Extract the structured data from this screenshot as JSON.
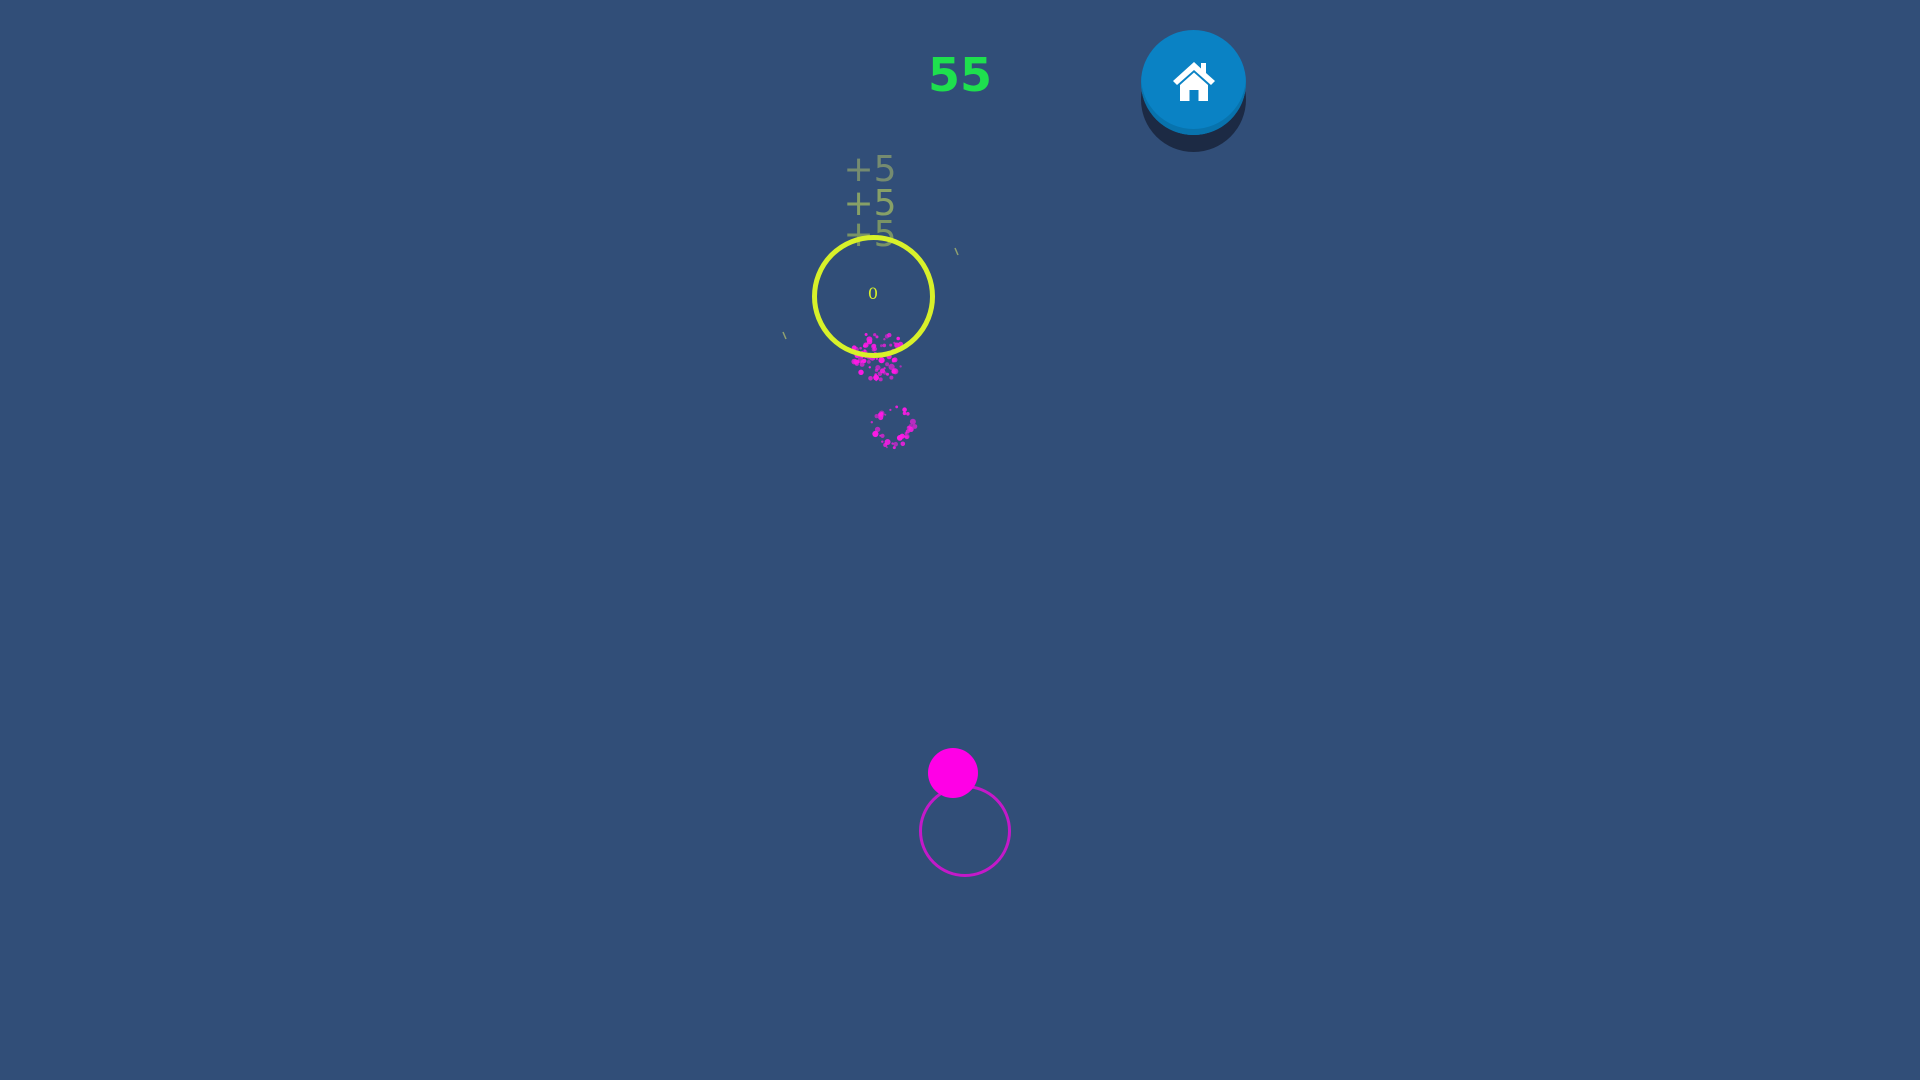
{
  "hud": {
    "score": "55",
    "home_button_icon": "home-icon"
  },
  "popups": [
    "+5",
    "+5",
    "+5"
  ],
  "target": {
    "label": "0",
    "ring_color": "#d8f12a"
  },
  "player": {
    "ball_color": "#ff00e6",
    "ring_color": "#c419c9"
  },
  "colors": {
    "background": "#314e78",
    "score": "#1ee04e",
    "home_button": "#0a82c4"
  }
}
